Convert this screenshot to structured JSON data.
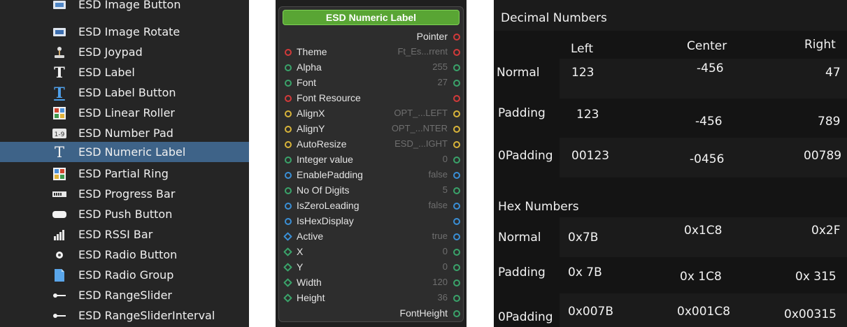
{
  "component_list": {
    "items": [
      {
        "label": "ESD Image Button",
        "icon": "image-button-icon"
      },
      {
        "label": "ESD Image Rotate",
        "icon": "image-rotate-icon"
      },
      {
        "label": "ESD Joypad",
        "icon": "joypad-icon"
      },
      {
        "label": "ESD Label",
        "icon": "label-icon"
      },
      {
        "label": "ESD Label Button",
        "icon": "label-button-icon"
      },
      {
        "label": "ESD Linear Roller",
        "icon": "linear-roller-icon"
      },
      {
        "label": "ESD Number Pad",
        "icon": "number-pad-icon"
      },
      {
        "label": "ESD Numeric Label",
        "icon": "numeric-label-icon",
        "selected": true
      },
      {
        "label": "ESD Partial Ring",
        "icon": "partial-ring-icon"
      },
      {
        "label": "ESD Progress Bar",
        "icon": "progress-bar-icon"
      },
      {
        "label": "ESD Push Button",
        "icon": "push-button-icon"
      },
      {
        "label": "ESD RSSI Bar",
        "icon": "rssi-bar-icon"
      },
      {
        "label": "ESD Radio Button",
        "icon": "radio-button-icon"
      },
      {
        "label": "ESD Radio Group",
        "icon": "radio-group-icon"
      },
      {
        "label": "ESD RangeSlider",
        "icon": "range-slider-icon"
      },
      {
        "label": "ESD RangeSliderInterval",
        "icon": "range-slider-interval-icon"
      }
    ],
    "colors": {
      "background": "#252525",
      "selected": "#3e6388",
      "text": "#f0f0f0"
    }
  },
  "node": {
    "title": "ESD Numeric Label",
    "header_output": "Pointer",
    "footer_output": "FontHeight",
    "properties": [
      {
        "name": "Theme",
        "value": "Ft_Es...rrent",
        "pin": "red"
      },
      {
        "name": "Alpha",
        "value": "255",
        "pin": "green"
      },
      {
        "name": "Font",
        "value": "27",
        "pin": "green"
      },
      {
        "name": "Font Resource",
        "value": "",
        "pin": "red"
      },
      {
        "name": "AlignX",
        "value": "OPT_...LEFT",
        "pin": "yellow"
      },
      {
        "name": "AlignY",
        "value": "OPT_...NTER",
        "pin": "yellow"
      },
      {
        "name": "AutoResize",
        "value": "ESD_...IGHT",
        "pin": "yellow"
      },
      {
        "name": "Integer value",
        "value": "0",
        "pin": "green"
      },
      {
        "name": "EnablePadding",
        "value": "false",
        "pin": "blue"
      },
      {
        "name": "No Of Digits",
        "value": "5",
        "pin": "green"
      },
      {
        "name": "IsZeroLeading",
        "value": "false",
        "pin": "blue"
      },
      {
        "name": "IsHexDisplay",
        "value": "",
        "pin": "blue"
      },
      {
        "name": "Active",
        "value": "true",
        "pin": "blue-diamond"
      },
      {
        "name": "X",
        "value": "0",
        "pin": "green-diamond"
      },
      {
        "name": "Y",
        "value": "0",
        "pin": "green-diamond"
      },
      {
        "name": "Width",
        "value": "120",
        "pin": "green-diamond"
      },
      {
        "name": "Height",
        "value": "36",
        "pin": "green-diamond"
      }
    ],
    "colors": {
      "title_bg": "#59a534",
      "pin_red": "#d23a3a",
      "pin_green": "#3aa36a",
      "pin_yellow": "#d8b43a",
      "pin_blue": "#3a8fd6",
      "value_text": "#6f6f6f"
    }
  },
  "preview": {
    "decimal_heading": "Decimal Numbers",
    "hex_heading": "Hex Numbers",
    "columns": {
      "left": "Left",
      "center": "Center",
      "right": "Right"
    },
    "decimal_rows": [
      {
        "label": "Normal",
        "left": "123",
        "center": "-456",
        "right": "47"
      },
      {
        "label": "Padding",
        "left": "123",
        "center": "-456",
        "right": "789"
      },
      {
        "label": "0Padding",
        "left": "00123",
        "center": "-0456",
        "right": "00789"
      }
    ],
    "hex_rows": [
      {
        "label": "Normal",
        "left": "0x7B",
        "center": "0x1C8",
        "right": "0x2F"
      },
      {
        "label": "Padding",
        "left": "0x 7B",
        "center": "0x 1C8",
        "right": "0x 315"
      },
      {
        "label": "0Padding",
        "left": "0x007B",
        "center": "0x001C8",
        "right": "0x00315"
      }
    ],
    "colors": {
      "background": "#141414",
      "band": "#1b1b1b",
      "text": "#f2f2f2"
    }
  }
}
